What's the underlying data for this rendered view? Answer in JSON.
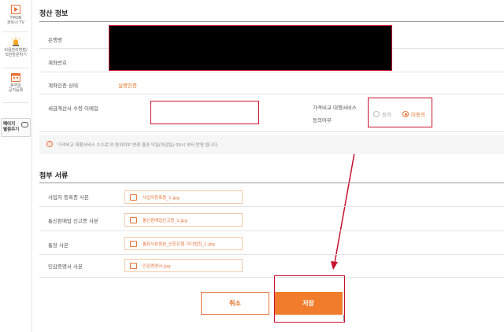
{
  "sidebar": {
    "items": [
      {
        "label": "TMON\n파트너 TV",
        "icon": "play-icon"
      },
      {
        "label": "비용관리방법/\n직원방문하기",
        "icon": "siren-icon"
      },
      {
        "label": "휴무일\n공지등록",
        "icon": "calendar-icon"
      }
    ],
    "page_button": {
      "label": "페이지\n별점주기",
      "icon": "chat-bubble-icon"
    }
  },
  "settlement": {
    "title": "정산 정보",
    "bank_label": "은행명",
    "account_label": "계좌번호",
    "auth_label": "계좌인증 상태",
    "auth_status": "실명인증",
    "invoice_email_label": "세금계산서 수령 이메일",
    "invoice_email_value": "",
    "agree_label_line1": "가격비교 대행서비스",
    "agree_label_line2": "동의여부",
    "options": [
      {
        "label": "동의",
        "selected": false
      },
      {
        "label": "미동의",
        "selected": true
      }
    ],
    "notice": "'가격비교 대행서비스 수수료'의 동의여부 변경 결과 익일(마감일) 00시 부터 반영 됩니다."
  },
  "attachments": {
    "title": "첨부 서류",
    "rows": [
      {
        "label": "사업자 등록증 사본",
        "file": "사업자등록증_1.jpg"
      },
      {
        "label": "통신판매업 신고증 사본",
        "file": "통신판매업신고증_1.jpg"
      },
      {
        "label": "통장 사본",
        "file": "통장사본원본_신한은행 가디법칭_1.jpg"
      },
      {
        "label": "인감증명서 사본",
        "file": "인감증명서.jpg"
      }
    ]
  },
  "actions": {
    "cancel": "취소",
    "save": "저장"
  },
  "colors": {
    "accent": "#f07c2c",
    "highlight": "#c8102e"
  }
}
